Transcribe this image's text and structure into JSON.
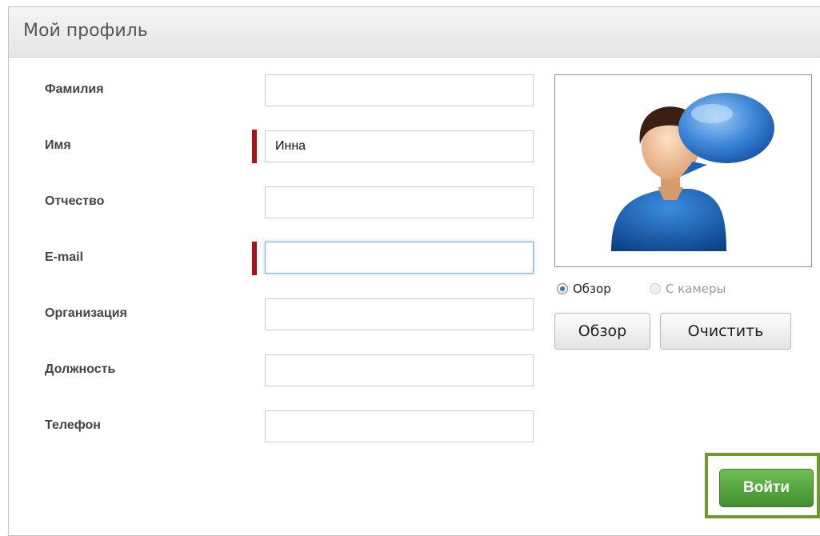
{
  "panel": {
    "title": "Мой профиль"
  },
  "form": {
    "fields": [
      {
        "label": "Фамилия",
        "value": "",
        "required": false
      },
      {
        "label": "Имя",
        "value": "Инна",
        "required": true
      },
      {
        "label": "Отчество",
        "value": "",
        "required": false
      },
      {
        "label": "E-mail",
        "value": "",
        "required": true,
        "focused": true
      },
      {
        "label": "Организация",
        "value": "",
        "required": false
      },
      {
        "label": "Должность",
        "value": "",
        "required": false
      },
      {
        "label": "Телефон",
        "value": "",
        "required": false
      }
    ]
  },
  "photo": {
    "icon": "user-avatar-with-speech-bubble-icon",
    "source_options": [
      {
        "label": "Обзор",
        "checked": true,
        "disabled": false
      },
      {
        "label": "С камеры",
        "checked": false,
        "disabled": true
      }
    ],
    "browse_label": "Обзор",
    "clear_label": "Очистить"
  },
  "actions": {
    "login_label": "Войти"
  },
  "colors": {
    "required_marker": "#b10e18",
    "login_button": "#4f9e3a",
    "login_highlight": "#6e9a2a",
    "focus_border": "#7eb1e0"
  }
}
